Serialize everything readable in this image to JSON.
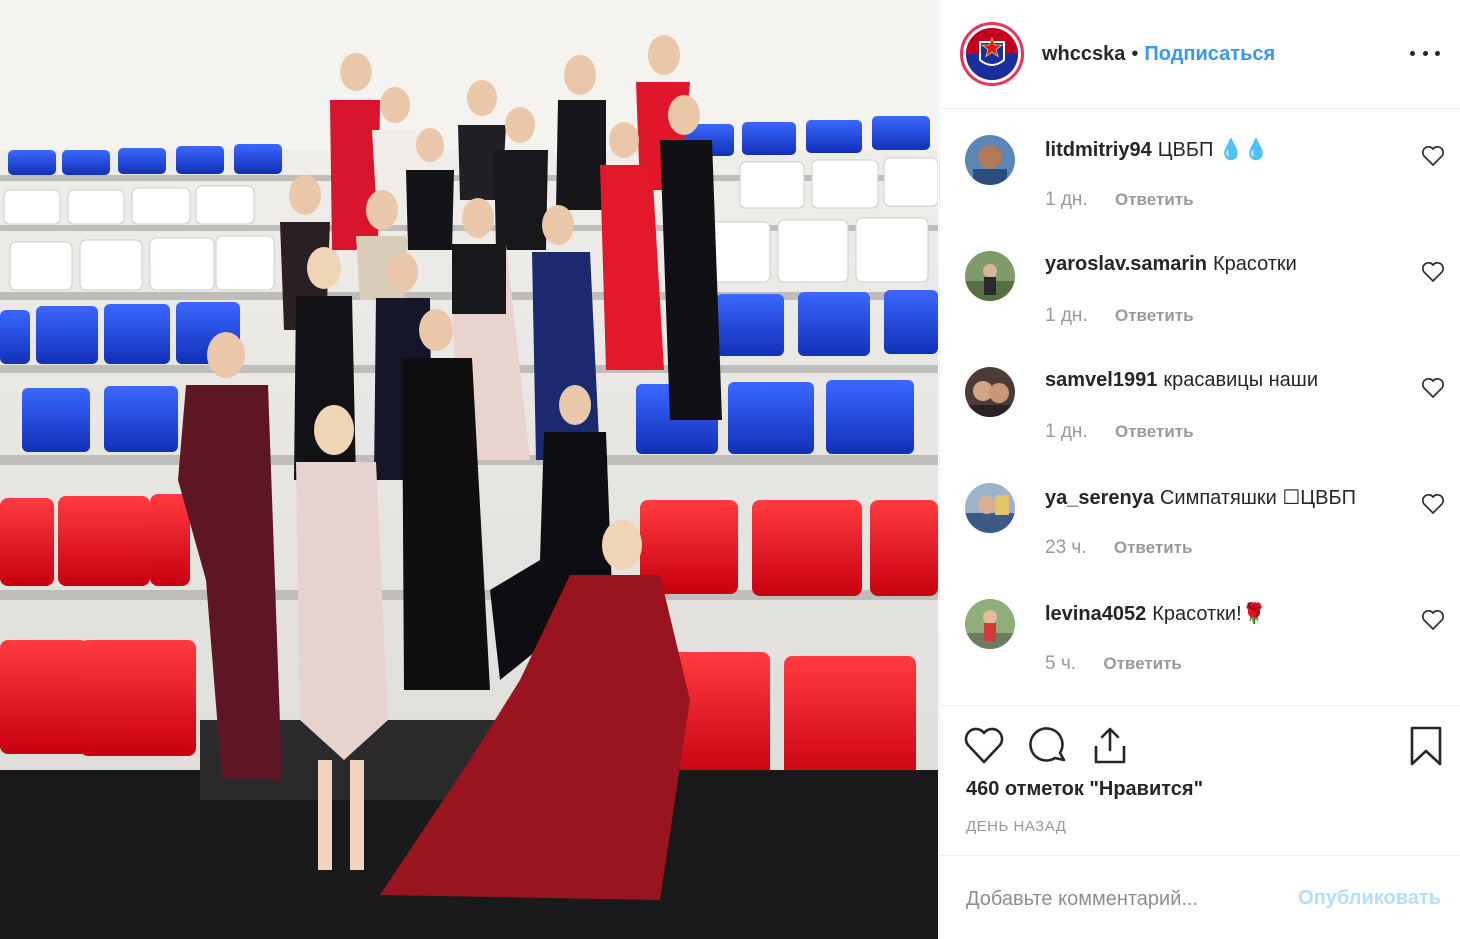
{
  "post": {
    "username": "whccska",
    "dot": "•",
    "follow_label": "Подписаться",
    "more_icon": "more-horizontal-icon"
  },
  "comments": [
    {
      "user": "litdmitriy94",
      "text": "ЦВБП 💧💧",
      "time": "1 дн.",
      "reply": "Ответить"
    },
    {
      "user": "yaroslav.samarin",
      "text": "Красотки",
      "time": "1 дн.",
      "reply": "Ответить"
    },
    {
      "user": "samvel1991",
      "text": "красавицы наши",
      "time": "1 дн.",
      "reply": "Ответить"
    },
    {
      "user": "ya_serenya",
      "text": "Симпатяшки ☐ЦВБП",
      "time": "23 ч.",
      "reply": "Ответить"
    },
    {
      "user": "levina4052",
      "text": "Красотки!🌹",
      "time": "5 ч.",
      "reply": "Ответить"
    }
  ],
  "actions": {
    "like_icon": "heart-icon",
    "comment_icon": "comment-bubble-icon",
    "share_icon": "share-icon",
    "save_icon": "bookmark-icon"
  },
  "likes_text": "460 отметок \"Нравится\"",
  "date_text": "ДЕНЬ НАЗАД",
  "comment_input": {
    "placeholder": "Добавьте комментарий..."
  },
  "publish_label": "Опубликовать",
  "colors": {
    "accent": "#3897f0",
    "publish_disabled": "#b2dffc",
    "seat_red": "#e8101e",
    "seat_blue": "#1a3fd0",
    "seat_white": "#ffffff"
  }
}
